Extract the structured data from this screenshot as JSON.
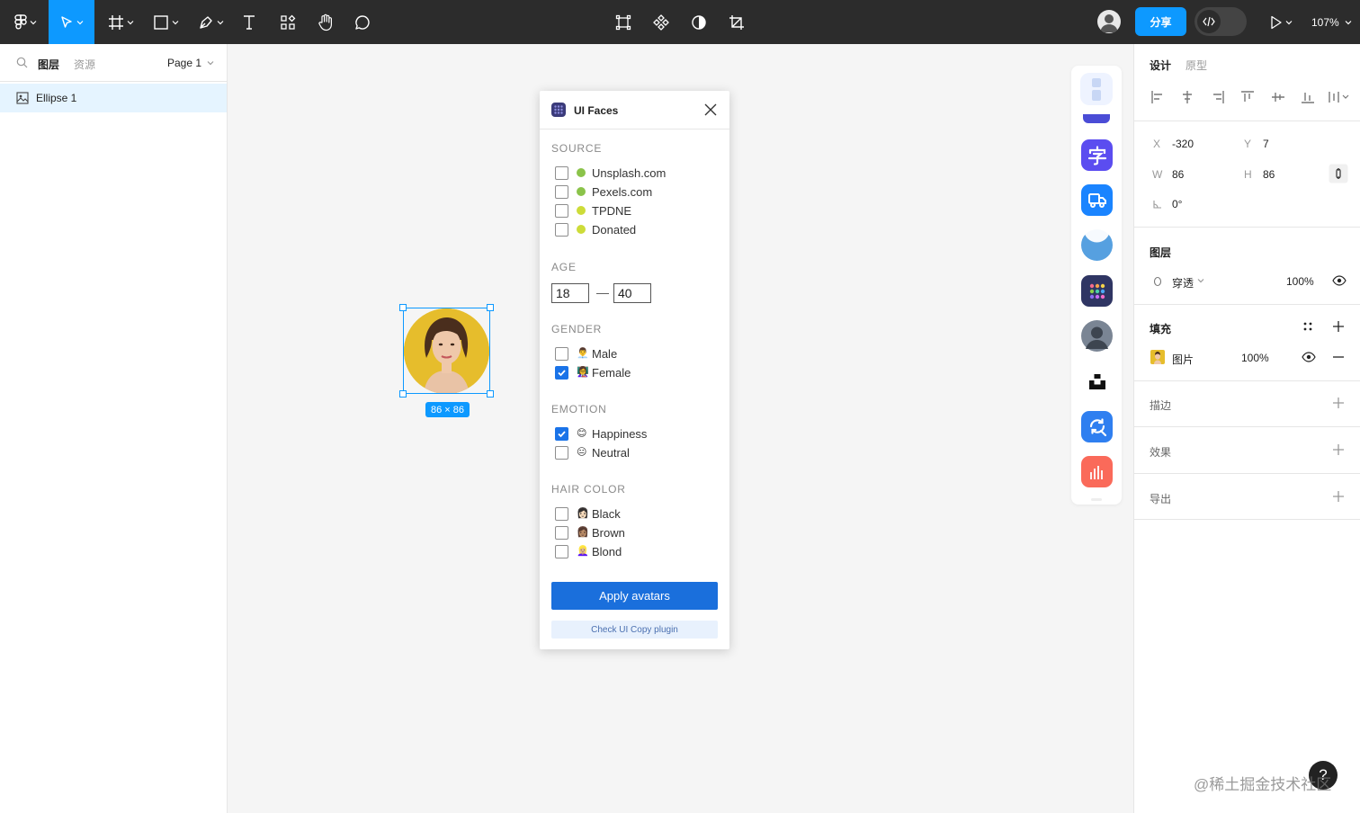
{
  "toolbar": {
    "share_label": "分享",
    "zoom_label": "107%"
  },
  "layers_panel": {
    "tab_layers": "图层",
    "tab_assets": "资源",
    "page_selector": "Page 1",
    "layers": [
      {
        "name": "Ellipse 1"
      }
    ]
  },
  "canvas": {
    "selection_size": "86 × 86"
  },
  "plugin": {
    "title": "UI Faces",
    "source_title": "SOURCE",
    "sources": [
      {
        "label": "Unsplash.com",
        "checked": false,
        "color": "#8bc34a"
      },
      {
        "label": "Pexels.com",
        "checked": false,
        "color": "#8bc34a"
      },
      {
        "label": "TPDNE",
        "checked": false,
        "color": "#cddc39"
      },
      {
        "label": "Donated",
        "checked": false,
        "color": "#cddc39"
      }
    ],
    "age_title": "AGE",
    "age_min": "18",
    "age_dash": "—",
    "age_max": "40",
    "gender_title": "GENDER",
    "genders": [
      {
        "label": "Male",
        "checked": false,
        "emoji": "👨‍💼"
      },
      {
        "label": "Female",
        "checked": true,
        "emoji": "👩‍🏫"
      }
    ],
    "emotion_title": "EMOTION",
    "emotions": [
      {
        "label": "Happiness",
        "checked": true,
        "emoji": "😊"
      },
      {
        "label": "Neutral",
        "checked": false,
        "emoji": "😐"
      }
    ],
    "hair_title": "HAIR COLOR",
    "hair": [
      {
        "label": "Black",
        "checked": false,
        "emoji": "👩🏻"
      },
      {
        "label": "Brown",
        "checked": false,
        "emoji": "👩🏽"
      },
      {
        "label": "Blond",
        "checked": false,
        "emoji": "👱🏼‍♀️"
      }
    ],
    "apply_label": "Apply avatars",
    "copy_label": "Check UI Copy plugin"
  },
  "design_panel": {
    "tab_design": "设计",
    "tab_prototype": "原型",
    "x_label": "X",
    "x_value": "-320",
    "y_label": "Y",
    "y_value": "7",
    "w_label": "W",
    "w_value": "86",
    "h_label": "H",
    "h_value": "86",
    "rotation_value": "0°",
    "layer_title": "图层",
    "blend_mode": "穿透",
    "layer_opacity": "100%",
    "fill_title": "填充",
    "fill_type": "图片",
    "fill_opacity": "100%",
    "stroke_title": "描边",
    "effects_title": "效果",
    "export_title": "导出"
  },
  "watermark": "@稀土掘金技术社区",
  "help_label": "?"
}
